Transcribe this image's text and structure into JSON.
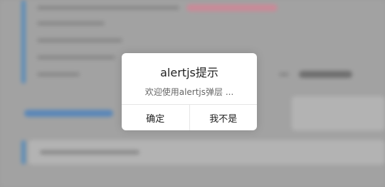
{
  "dialog": {
    "title": "alertjs提示",
    "message": "欢迎使用alertjs弹层 ...",
    "confirm_label": "确定",
    "cancel_label": "我不是"
  },
  "colors": {
    "overlay": "#a2a2a2",
    "accent_bar": "#5b8db8",
    "dialog_bg": "#ffffff"
  }
}
